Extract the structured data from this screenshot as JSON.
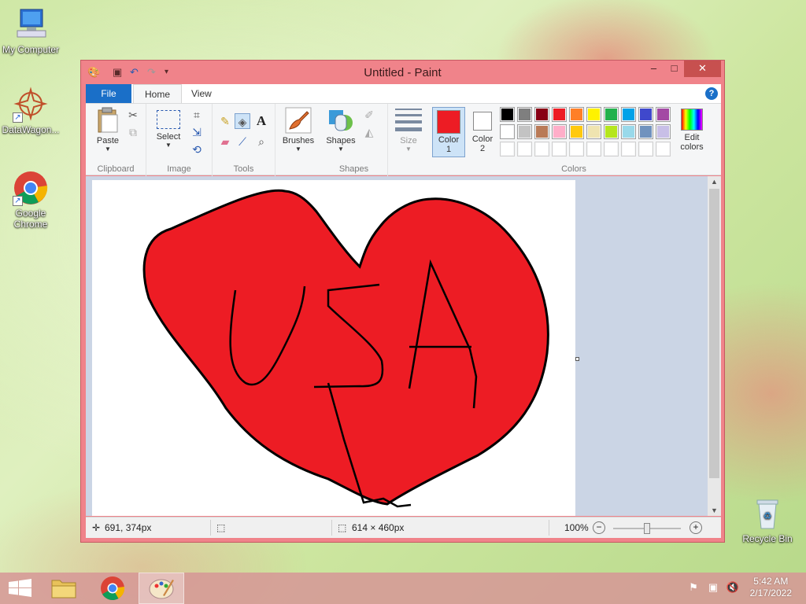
{
  "desktop": {
    "icons": [
      {
        "label": "My Computer"
      },
      {
        "label": "DataWagon..."
      },
      {
        "label": "Google Chrome"
      },
      {
        "label": "Recycle Bin"
      }
    ]
  },
  "window": {
    "title": "Untitled - Paint",
    "tabs": {
      "file": "File",
      "home": "Home",
      "view": "View"
    },
    "ribbon": {
      "clipboard": {
        "paste": "Paste",
        "group": "Clipboard"
      },
      "image": {
        "select": "Select",
        "group": "Image"
      },
      "tools": {
        "group": "Tools"
      },
      "brushes": {
        "label": "Brushes"
      },
      "shapes": {
        "label": "Shapes",
        "group": "Shapes"
      },
      "size": {
        "label": "Size"
      },
      "color1": {
        "label1": "Color",
        "label2": "1",
        "value": "#ed1c24"
      },
      "color2": {
        "label1": "Color",
        "label2": "2",
        "value": "#ffffff"
      },
      "edit_colors": {
        "label1": "Edit",
        "label2": "colors"
      },
      "colors_group": "Colors",
      "palette_row1": [
        "#000000",
        "#7f7f7f",
        "#880015",
        "#ed1c24",
        "#ff7f27",
        "#fff200",
        "#22b14c",
        "#00a2e8",
        "#3f48cc",
        "#a349a4"
      ],
      "palette_row2": [
        "#ffffff",
        "#c3c3c3",
        "#b97a57",
        "#ffaec9",
        "#ffc90e",
        "#efe4b0",
        "#b5e61d",
        "#99d9ea",
        "#7092be",
        "#c8bfe7"
      ],
      "palette_row3": [
        "#ffffff",
        "#ffffff",
        "#ffffff",
        "#ffffff",
        "#ffffff",
        "#ffffff",
        "#ffffff",
        "#ffffff",
        "#ffffff",
        "#ffffff"
      ]
    },
    "status": {
      "cursor_pos": "691, 374px",
      "canvas_size": "614 × 460px",
      "zoom": "100%",
      "zoom_level": 0.5
    }
  },
  "taskbar": {
    "time": "5:42 AM",
    "date": "2/17/2022"
  }
}
